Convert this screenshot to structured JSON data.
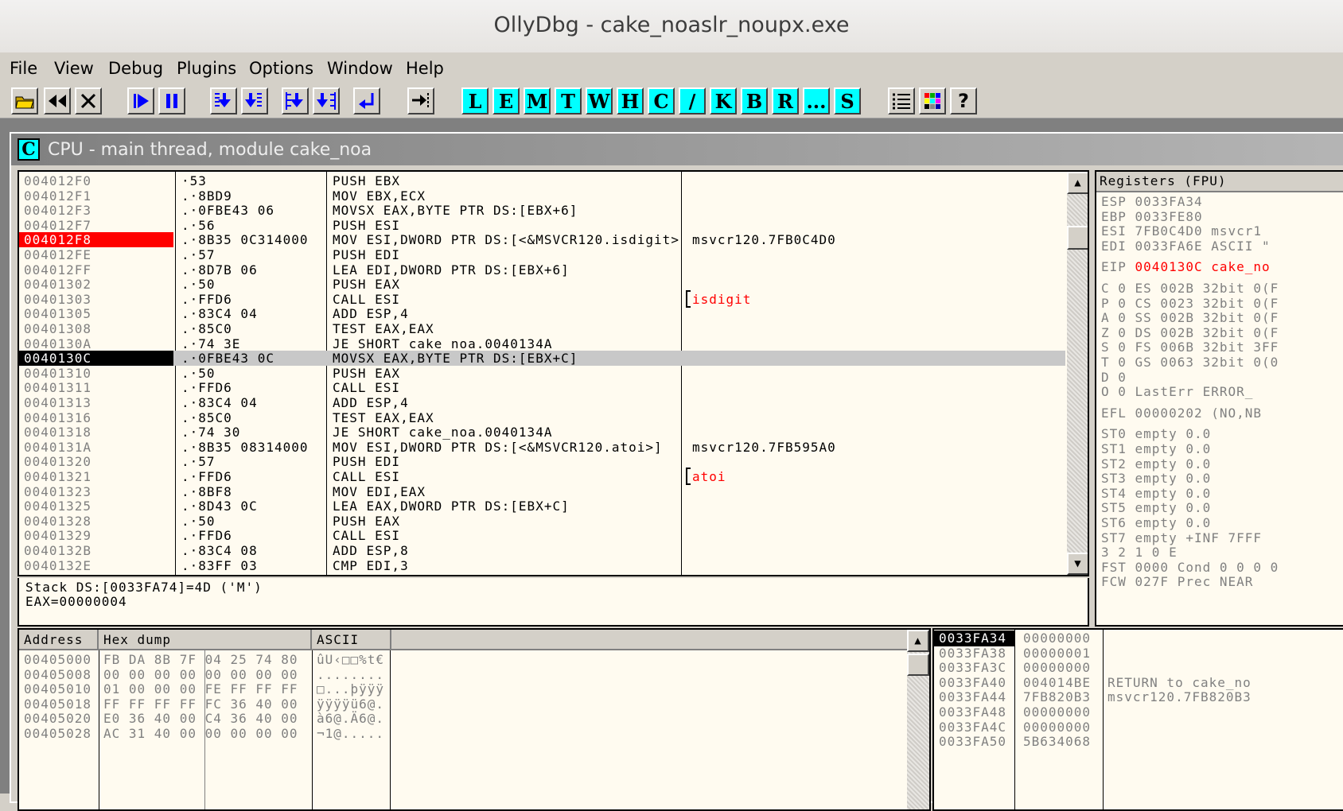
{
  "window": {
    "title": "OllyDbg - cake_noaslr_noupx.exe"
  },
  "menu": [
    "File",
    "View",
    "Debug",
    "Plugins",
    "Options",
    "Window",
    "Help"
  ],
  "toolbar": {
    "icons": [
      "open-icon",
      "restart-icon",
      "close-icon",
      "run-icon",
      "pause-icon",
      "step-into-icon",
      "step-over-icon",
      "trace-into-icon",
      "trace-over-icon",
      "execute-till-return-icon",
      "go-to-icon"
    ],
    "letters": [
      "L",
      "E",
      "M",
      "T",
      "W",
      "H",
      "C",
      "/",
      "K",
      "B",
      "R",
      "...",
      "S"
    ],
    "right_icons": [
      "list-icon",
      "colors-icon",
      "help-icon"
    ],
    "help_glyph": "?"
  },
  "cpu": {
    "icon_letter": "C",
    "title": "CPU - main thread, module cake_noa",
    "disasm": [
      {
        "addr": "004012F0",
        "hex": "·53",
        "instr": "PUSH EBX",
        "comment": ""
      },
      {
        "addr": "004012F1",
        "hex": ".·8BD9",
        "instr": "MOV EBX,ECX",
        "comment": ""
      },
      {
        "addr": "004012F3",
        "hex": ".·0FBE43 06",
        "instr": "MOVSX EAX,BYTE PTR DS:[EBX+6]",
        "comment": ""
      },
      {
        "addr": "004012F7",
        "hex": ".·56",
        "instr": "PUSH ESI",
        "comment": ""
      },
      {
        "addr": "004012F8",
        "hex": ".·8B35 0C314000",
        "instr": "MOV ESI,DWORD PTR DS:[<&MSVCR120.isdigit>",
        "comment": "msvcr120.7FB0C4D0"
      },
      {
        "addr": "004012FE",
        "hex": ".·57",
        "instr": "PUSH EDI",
        "comment": ""
      },
      {
        "addr": "004012FF",
        "hex": ".·8D7B 06",
        "instr": "LEA EDI,DWORD PTR DS:[EBX+6]",
        "comment": ""
      },
      {
        "addr": "00401302",
        "hex": ".·50",
        "instr": "PUSH EAX",
        "comment": ""
      },
      {
        "addr": "00401303",
        "hex": ".·FFD6",
        "instr": "CALL ESI",
        "comment": "isdigit"
      },
      {
        "addr": "00401305",
        "hex": ".·83C4 04",
        "instr": "ADD ESP,4",
        "comment": ""
      },
      {
        "addr": "00401308",
        "hex": ".·85C0",
        "instr": "TEST EAX,EAX",
        "comment": ""
      },
      {
        "addr": "0040130A",
        "hex": ".·74 3E",
        "instr": "JE SHORT cake_noa.0040134A",
        "comment": ""
      },
      {
        "addr": "0040130C",
        "hex": ".·0FBE43 0C",
        "instr": "MOVSX EAX,BYTE PTR DS:[EBX+C]",
        "comment": ""
      },
      {
        "addr": "00401310",
        "hex": ".·50",
        "instr": "PUSH EAX",
        "comment": ""
      },
      {
        "addr": "00401311",
        "hex": ".·FFD6",
        "instr": "CALL ESI",
        "comment": ""
      },
      {
        "addr": "00401313",
        "hex": ".·83C4 04",
        "instr": "ADD ESP,4",
        "comment": ""
      },
      {
        "addr": "00401316",
        "hex": ".·85C0",
        "instr": "TEST EAX,EAX",
        "comment": ""
      },
      {
        "addr": "00401318",
        "hex": ".·74 30",
        "instr": "JE SHORT cake_noa.0040134A",
        "comment": ""
      },
      {
        "addr": "0040131A",
        "hex": ".·8B35 08314000",
        "instr": "MOV ESI,DWORD PTR DS:[<&MSVCR120.atoi>]",
        "comment": "msvcr120.7FB595A0"
      },
      {
        "addr": "00401320",
        "hex": ".·57",
        "instr": "PUSH EDI",
        "comment": ""
      },
      {
        "addr": "00401321",
        "hex": ".·FFD6",
        "instr": "CALL ESI",
        "comment": "atoi"
      },
      {
        "addr": "00401323",
        "hex": ".·8BF8",
        "instr": "MOV EDI,EAX",
        "comment": ""
      },
      {
        "addr": "00401325",
        "hex": ".·8D43 0C",
        "instr": "LEA EAX,DWORD PTR DS:[EBX+C]",
        "comment": ""
      },
      {
        "addr": "00401328",
        "hex": ".·50",
        "instr": "PUSH EAX",
        "comment": ""
      },
      {
        "addr": "00401329",
        "hex": ".·FFD6",
        "instr": "CALL ESI",
        "comment": ""
      },
      {
        "addr": "0040132B",
        "hex": ".·83C4 08",
        "instr": "ADD ESP,8",
        "comment": ""
      },
      {
        "addr": "0040132E",
        "hex": ".·83FF 03",
        "instr": "CMP EDI,3",
        "comment": ""
      }
    ],
    "info": [
      "Stack DS:[0033FA74]=4D ('M')",
      "EAX=00000004"
    ],
    "registers": {
      "header": "Registers (FPU)",
      "lines": [
        {
          "t": "ESP 0033FA34",
          "gap": false
        },
        {
          "t": "EBP 0033FE80",
          "gap": false
        },
        {
          "t": "ESI 7FB0C4D0 msvcr1",
          "gap": false
        },
        {
          "t": "EDI 0033FA6E ASCII \"",
          "gap": false
        },
        {
          "t": "EIP",
          "v": "0040130C",
          "r": "cake_no",
          "gap": true
        },
        {
          "t": "C 0  ES 002B 32bit 0(F",
          "gap": true
        },
        {
          "t": "P 0  CS 0023 32bit 0(F",
          "gap": false
        },
        {
          "t": "A 0  SS 002B 32bit 0(F",
          "gap": false
        },
        {
          "t": "Z 0  DS 002B 32bit 0(F",
          "gap": false
        },
        {
          "t": "S 0  FS 006B 32bit 3FF",
          "gap": false
        },
        {
          "t": "T 0  GS 0063 32bit 0(0",
          "gap": false
        },
        {
          "t": "D 0",
          "gap": false
        },
        {
          "t": "O 0  LastErr ERROR_",
          "gap": false
        },
        {
          "t": "EFL 00000202 (NO,NB",
          "gap": true
        },
        {
          "t": "ST0 empty 0.0",
          "gap": true
        },
        {
          "t": "ST1 empty 0.0",
          "gap": false
        },
        {
          "t": "ST2 empty 0.0",
          "gap": false
        },
        {
          "t": "ST3 empty 0.0",
          "gap": false
        },
        {
          "t": "ST4 empty 0.0",
          "gap": false
        },
        {
          "t": "ST5 empty 0.0",
          "gap": false
        },
        {
          "t": "ST6 empty 0.0",
          "gap": false
        },
        {
          "t": "ST7 empty +INF 7FFF",
          "gap": false
        },
        {
          "t": "           3 2 1 0      E",
          "gap": false
        },
        {
          "t": "FST 0000  Cond 0 0 0 0",
          "gap": false
        },
        {
          "t": "FCW 027F  Prec NEAR",
          "gap": false
        }
      ]
    },
    "dump": {
      "headers": [
        "Address",
        "Hex dump",
        "ASCII"
      ],
      "rows": [
        {
          "addr": "00405000",
          "hex": "FB DA 8B 7F 04 25 74 80",
          "ascii": "ûU‹□□%t€"
        },
        {
          "addr": "00405008",
          "hex": "00 00 00 00 00 00 00 00",
          "ascii": "........"
        },
        {
          "addr": "00405010",
          "hex": "01 00 00 00 FE FF FF FF",
          "ascii": "□...þÿÿÿ"
        },
        {
          "addr": "00405018",
          "hex": "FF FF FF FF FC 36 40 00",
          "ascii": "ÿÿÿÿü6@."
        },
        {
          "addr": "00405020",
          "hex": "E0 36 40 00 C4 36 40 00",
          "ascii": "à6@.Ä6@."
        },
        {
          "addr": "00405028",
          "hex": "AC 31 40 00 00 00 00 00",
          "ascii": "¬1@....."
        }
      ]
    },
    "stack": [
      {
        "addr": "0033FA34",
        "val": "00000000",
        "comment": ""
      },
      {
        "addr": "0033FA38",
        "val": "00000001",
        "comment": ""
      },
      {
        "addr": "0033FA3C",
        "val": "00000000",
        "comment": ""
      },
      {
        "addr": "0033FA40",
        "val": "004014BE",
        "comment": "RETURN to cake_no"
      },
      {
        "addr": "0033FA44",
        "val": "7FB820B3",
        "comment": "msvcr120.7FB820B3"
      },
      {
        "addr": "0033FA48",
        "val": "00000000",
        "comment": ""
      },
      {
        "addr": "0033FA4C",
        "val": "00000000",
        "comment": ""
      },
      {
        "addr": "0033FA50",
        "val": "5B634068",
        "comment": ""
      }
    ]
  },
  "colors": {
    "eip_bg": "#000000",
    "bp_bg": "#ff0000",
    "panel_bg": "#fffbf0",
    "letter_btn": "#00ffff"
  }
}
